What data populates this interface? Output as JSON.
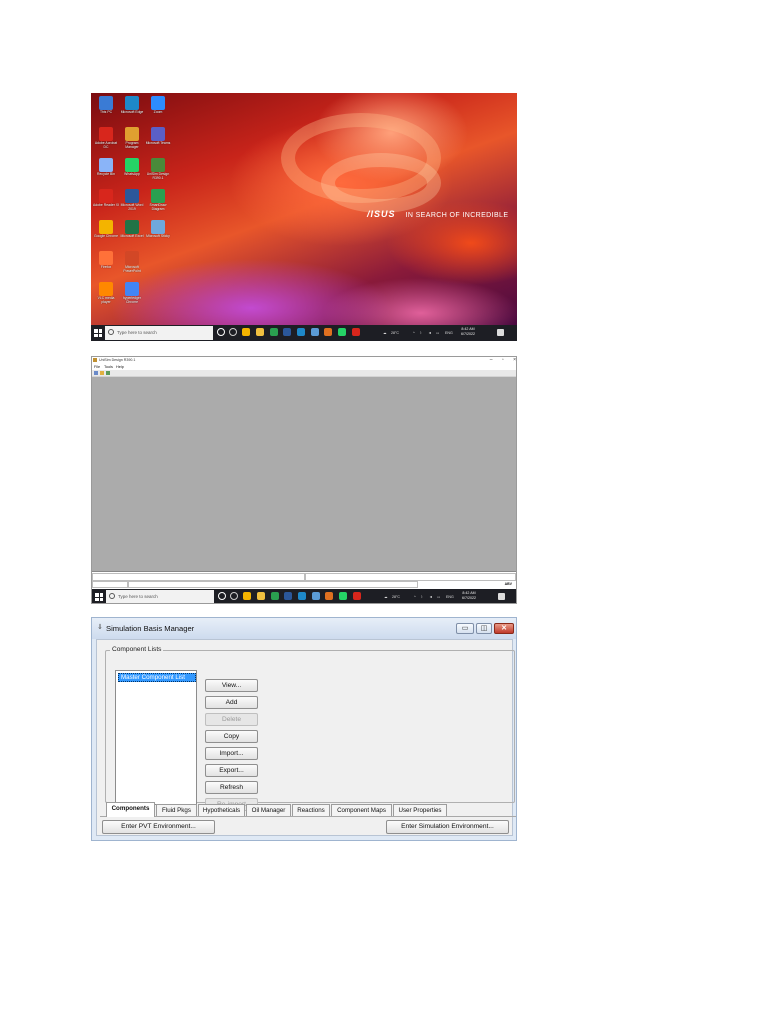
{
  "desktop": {
    "icons": [
      {
        "label": "This PC",
        "color": "#3a7bd5"
      },
      {
        "label": "Microsoft Edge",
        "color": "#1e88c8"
      },
      {
        "label": "Zoom",
        "color": "#2d8cff"
      },
      {
        "label": "Adobe Acrobat DC",
        "color": "#d8261c"
      },
      {
        "label": "Program Manager",
        "color": "#e0a030"
      },
      {
        "label": "Microsoft Teams",
        "color": "#5b5fc7"
      },
      {
        "label": "Recycle Bin",
        "color": "#8ab4f8"
      },
      {
        "label": "WhatsApp",
        "color": "#25d366"
      },
      {
        "label": "UniSim Design R390.1",
        "color": "#4a8a3a"
      },
      {
        "label": "Adobe Reader XI",
        "color": "#d8261c"
      },
      {
        "label": "Microsoft Word 2019",
        "color": "#2b579a"
      },
      {
        "label": "SmartDraw Diagram",
        "color": "#2aa050"
      },
      {
        "label": "Google Chrome",
        "color": "#f4b400"
      },
      {
        "label": "Microsoft Excel",
        "color": "#217346"
      },
      {
        "label": "Microsoft Sticky",
        "color": "#6fa8dc"
      },
      {
        "label": "Firefox",
        "color": "#ff7139"
      },
      {
        "label": "Microsoft PowerPoint",
        "color": "#d24726"
      },
      {
        "label": "VLC media player",
        "color": "#ff8800"
      },
      {
        "label": "hyperledger Chrome",
        "color": "#4285f4"
      }
    ],
    "brand_logo": "/ISUS",
    "brand_tagline": "IN SEARCH OF INCREDIBLE"
  },
  "taskbar": {
    "search_placeholder": "Type here to search",
    "temperature": "28°C",
    "language": "ENG",
    "time": "8:42 AM",
    "date": "6/7/2022",
    "app_colors": [
      "#ffffff",
      "#cccccc",
      "#f4b400",
      "#f0c040",
      "#2aa050",
      "#2b579a",
      "#1e88c8",
      "#5b9bd5",
      "#e07020",
      "#25d366",
      "#d8261c"
    ]
  },
  "unisim": {
    "title": "UniSim Design R390.1",
    "menu": [
      "File",
      "Tools",
      "Help"
    ],
    "status_text": "ABV"
  },
  "basis_manager": {
    "title": "Simulation Basis Manager",
    "group_label": "Component Lists",
    "list_items": [
      "Master Component List"
    ],
    "buttons": [
      {
        "label": "View...",
        "enabled": true
      },
      {
        "label": "Add",
        "enabled": true
      },
      {
        "label": "Delete",
        "enabled": false
      },
      {
        "label": "Copy",
        "enabled": true
      },
      {
        "label": "Import...",
        "enabled": true
      },
      {
        "label": "Export...",
        "enabled": true
      },
      {
        "label": "Refresh",
        "enabled": true
      },
      {
        "label": "Re-import",
        "enabled": false
      }
    ],
    "tabs": [
      "Components",
      "Fluid Pkgs",
      "Hypotheticals",
      "Oil Manager",
      "Reactions",
      "Component Maps",
      "User Properties"
    ],
    "active_tab": "Components",
    "enter_pvt": "Enter PVT Environment...",
    "enter_sim": "Enter Simulation Environment..."
  }
}
